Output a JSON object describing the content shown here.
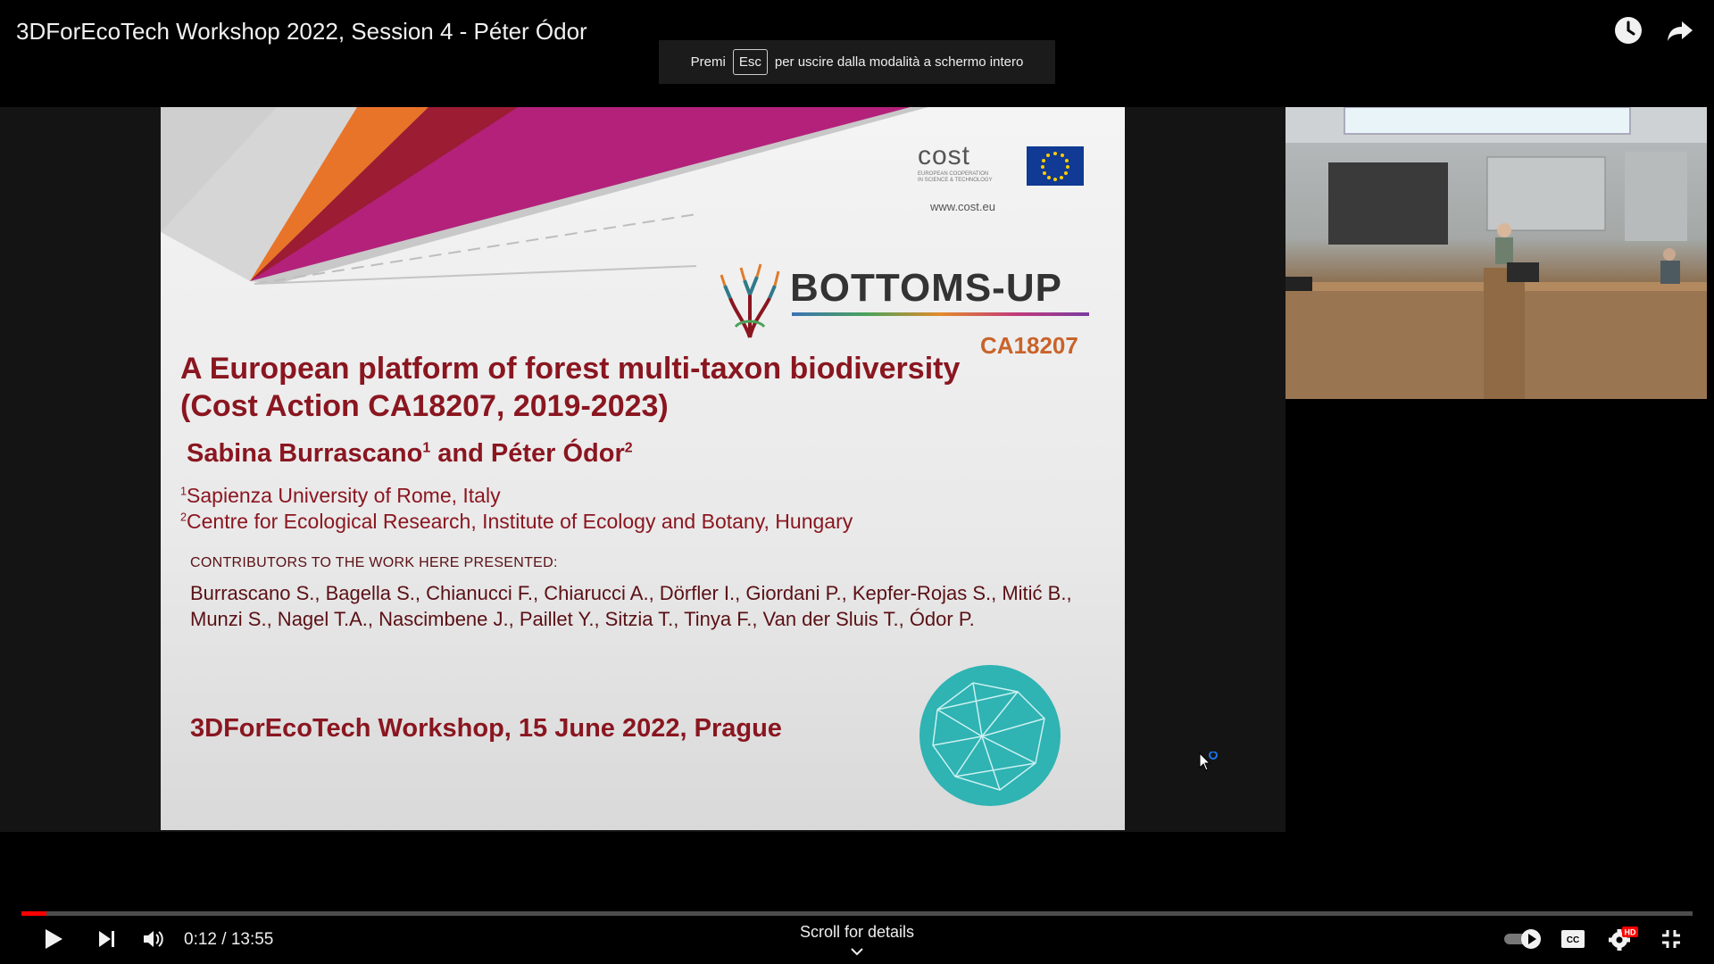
{
  "player": {
    "video_title": "3DForEcoTech Workshop 2022, Session 4 - Péter Ódor",
    "watch_later_icon": "clock-icon",
    "share_icon": "share-icon"
  },
  "fullscreen_toast": {
    "prefix": "Premi",
    "key": "Esc",
    "suffix": "per uscire dalla modalità a schermo intero"
  },
  "slide": {
    "cost_word": "cost",
    "cost_sub1": "European Cooperation",
    "cost_sub2": "in Science & Technology",
    "cost_url": "www.cost.eu",
    "logo_word": "BOTTOMS-UP",
    "action_code": "CA18207",
    "heading_line1": "A European platform of forest multi-taxon biodiversity",
    "heading_line2": "(Cost Action CA18207, 2019-2023)",
    "author1": "Sabina Burrascano",
    "author1_sup": "1",
    "author_join": " and Péter Ódor",
    "author2_sup": "2",
    "aff1_sup": "1",
    "aff1": "Sapienza University of Rome, Italy",
    "aff2_sup": "2",
    "aff2": "Centre for Ecological Research, Institute of Ecology and Botany, Hungary",
    "contributors_heading": "CONTRIBUTORS TO THE WORK HERE PRESENTED:",
    "contributors_line1": "Burrascano S., Bagella S., Chianucci F., Chiarucci A., Dörfler I., Giordani P., Kepfer-Rojas S., Mitić B.,",
    "contributors_line2": "Munzi S., Nagel T.A., Nascimbene J., Paillet Y., Sitzia T., Tinya F., Van der Sluis T., Ódor P.",
    "event": "3DForEcoTech Workshop, 15 June 2022, Prague"
  },
  "controls": {
    "progress": 0.0148,
    "current_time": "0:12",
    "separator": " / ",
    "duration": "13:55",
    "scroll_hint": "Scroll for details",
    "play_icon": "play-icon",
    "next_icon": "next-icon",
    "volume_icon": "volume-icon",
    "autoplay_icon": "autoplay-toggle-icon",
    "cc_label": "CC",
    "hd_label": "HD",
    "settings_icon": "gear-icon",
    "exit_fullscreen_icon": "exit-fullscreen-icon"
  },
  "colors": {
    "accent_red": "#ff0000",
    "slide_title": "#8a1620",
    "slide_code": "#c9632a"
  }
}
